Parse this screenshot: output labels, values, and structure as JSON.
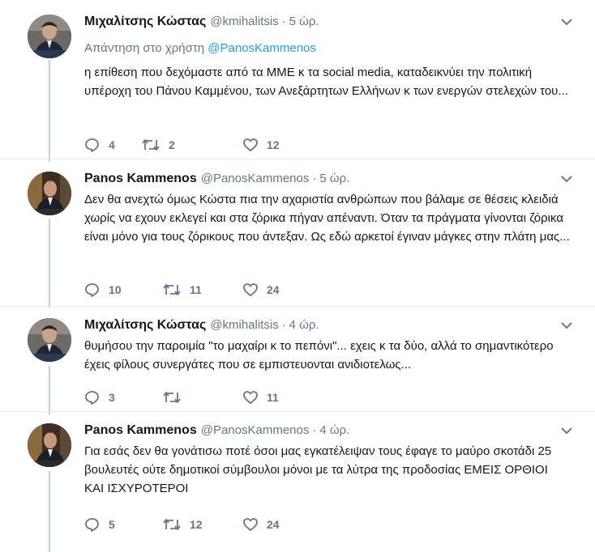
{
  "tweets": [
    {
      "author": "Μιχαλίτσης Κώστας",
      "handle": "@kmihalitsis",
      "time": "5 ώρ.",
      "reply_prefix": "Απάντηση στο χρήστη",
      "reply_mention": "@PanosKammenos",
      "text": "η επίθεση που δεχόμαστε από τα ΜΜΕ κ τα social media, καταδεικνύει την πολιτική υπέροχη του Πάνου Καμμένου, των Ανεξάρτητων Ελλήνων κ των ενεργών στελεχών του...",
      "replies": "4",
      "retweets": "2",
      "likes": "12"
    },
    {
      "author": "Panos Kammenos",
      "handle": "@PanosKammenos",
      "time": "5 ώρ.",
      "text": "Δεν θα ανεχτώ όμως Κώστα πια την αχαριστία ανθρώπων που βάλαμε σε θέσεις κλειδιά χωρίς να εχουν εκλεγεί και στα ζόρικα πήγαν απέναντι. Όταν τα πράγματα γίνονται ζόρικα είναι μόνο για τους ζόρικους που άντεξαν. Ως εδώ αρκετοί έγιναν μάγκες στην πλάτη μας...",
      "replies": "10",
      "retweets": "11",
      "likes": "24"
    },
    {
      "author": "Μιχαλίτσης Κώστας",
      "handle": "@kmihalitsis",
      "time": "4 ώρ.",
      "text": "θυμήσου την παροιμία \"το μαχαίρι κ το πεπόνι\"... εχεις κ τα δύο, αλλά το σημαντικότερο έχεις φίλους συνεργάτες που σε εμπιστευονται ανιδιοτελως...",
      "replies": "3",
      "retweets": "",
      "likes": "11"
    },
    {
      "author": "Panos Kammenos",
      "handle": "@PanosKammenos",
      "time": "4 ώρ.",
      "text": "Για εσάς δεν θα γονάτισω ποτέ όσοι μας εγκατέλειψαν τους έφαγε το μαύρο σκοτάδι 25 βουλευτές ούτε δημοτικοί σύμβουλοι μόνοι με τα λύτρα της προδοσίας ΕΜΕΙΣ ΟΡΘΙΟΙ ΚΑΙ ΙΣΧΥΡΟΤΕΡΟΙ",
      "replies": "5",
      "retweets": "12",
      "likes": "24"
    }
  ],
  "colors": {
    "text": "#14171a",
    "secondary": "#657786",
    "link": "#1da1f2",
    "thread_line": "#c4cfd6",
    "divider": "#e6ecf0"
  },
  "icons": {
    "reply": "reply-icon",
    "retweet": "retweet-icon",
    "like": "heart-icon",
    "more": "chevron-down-icon"
  }
}
